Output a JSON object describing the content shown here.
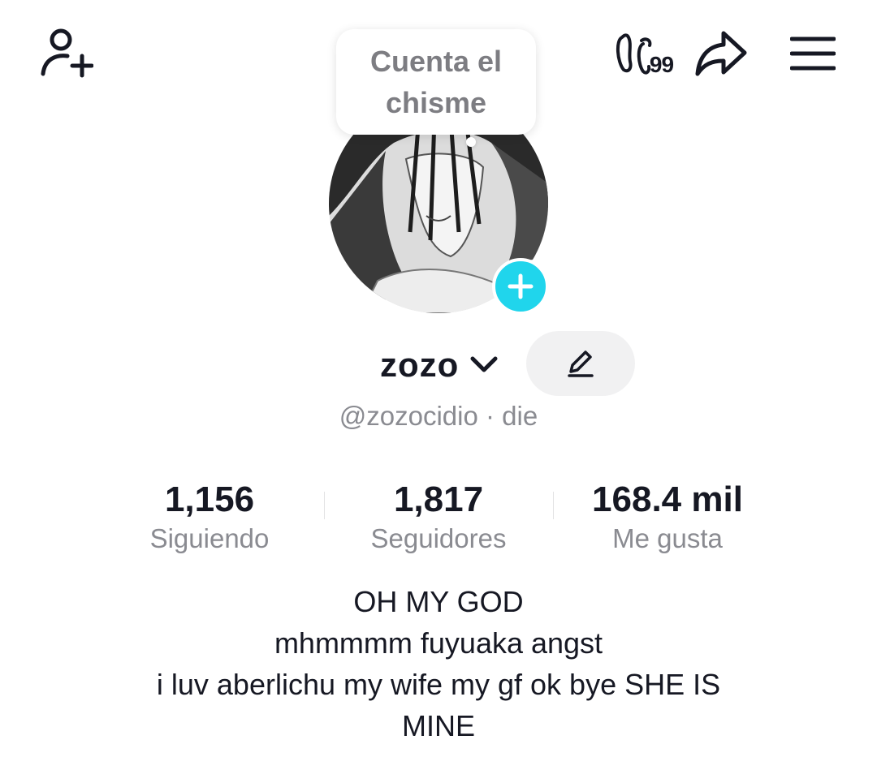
{
  "header": {
    "icons": {
      "add_friend": "add-person-icon",
      "counter": "footprint-icon",
      "share": "share-arrow-icon",
      "menu": "hamburger-menu-icon"
    },
    "counter_badge": "99"
  },
  "tooltip": {
    "text": "Cuenta el chisme"
  },
  "profile": {
    "display_name": "zozo",
    "handle_line": "@zozocidio · die",
    "accent_color": "#20d5ec"
  },
  "stats": [
    {
      "value": "1,156",
      "label": "Siguiendo"
    },
    {
      "value": "1,817",
      "label": "Seguidores"
    },
    {
      "value": "168.4 mil",
      "label": "Me gusta"
    }
  ],
  "bio": {
    "lines": [
      "OH MY GOD",
      "mhmmmm fuyuaka angst",
      "i luv aberlichu my wife my gf ok bye SHE IS",
      "MINE"
    ]
  }
}
